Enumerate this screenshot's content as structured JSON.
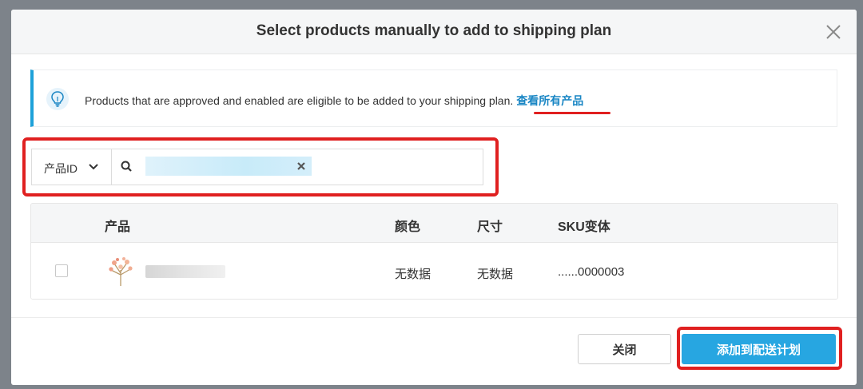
{
  "modal": {
    "title": "Select products manually to add to shipping plan",
    "close_icon": "close-icon"
  },
  "info": {
    "icon": "lightbulb-icon",
    "text": "Products that are approved and enabled are eligible to be added to your shipping plan.",
    "link": "查看所有产品"
  },
  "search": {
    "filter_label": "产品ID",
    "input_value": "",
    "search_icon": "search-icon",
    "clear_icon": "clear-icon"
  },
  "table": {
    "headers": {
      "product": "产品",
      "color": "颜色",
      "size": "尺寸",
      "sku": "SKU变体"
    },
    "rows": [
      {
        "color": "无数据",
        "size": "无数据",
        "sku": "......0000003"
      }
    ]
  },
  "footer": {
    "close_label": "关闭",
    "add_label": "添加到配送计划"
  },
  "colors": {
    "accent": "#27a6e1",
    "link": "#1a86c4",
    "annotation": "#e02020"
  }
}
